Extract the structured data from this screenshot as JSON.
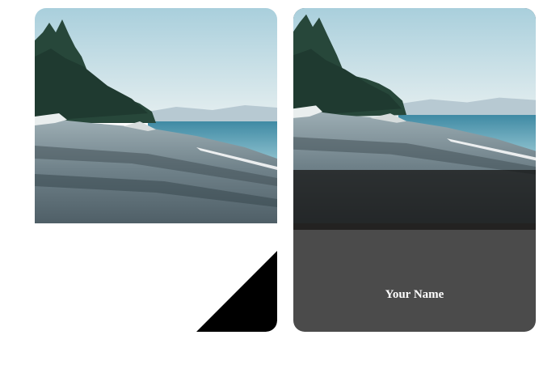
{
  "cards": {
    "left": {
      "photo_icon": "beach-photo",
      "corner_color": "#000000"
    },
    "right": {
      "photo_icon": "beach-photo",
      "panel_color": "#4b4b4b",
      "name": "Your Name"
    }
  },
  "colors": {
    "sky": "#cfe3ea",
    "sea": "#5f9db3",
    "trees": "#2d4a3c",
    "stones": "#8e9ba2",
    "panel": "#4b4b4b"
  }
}
